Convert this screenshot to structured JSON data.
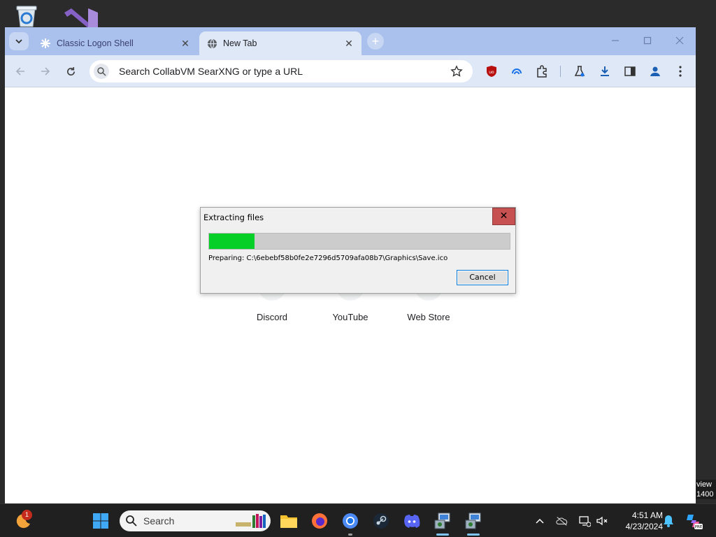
{
  "desktop": {
    "icons": [
      "recycle-bin-icon",
      "visual-studio-icon"
    ]
  },
  "browser": {
    "tabs": [
      {
        "label": "Classic Logon Shell",
        "icon": "spark-icon",
        "active": false
      },
      {
        "label": "New Tab",
        "icon": "globe-icon",
        "active": true
      }
    ],
    "omnibox": {
      "placeholder": "Search CollabVM SearXNG or type a URL"
    },
    "shortcuts": [
      {
        "label": "Discord"
      },
      {
        "label": "YouTube"
      },
      {
        "label": "Web Store"
      }
    ],
    "colors": {
      "tabstrip": "#a9c1ec",
      "toolbar": "#dfe8f7"
    }
  },
  "dialog": {
    "title": "Extracting files",
    "close": "✕",
    "progress": 0.15,
    "status": "Preparing: C:\\6ebebf58b0fe2e7296d5709afa08b7\\Graphics\\Save.ico",
    "cancel_label": "Cancel",
    "colors": {
      "progress_fill": "#06d027"
    }
  },
  "edge_fragment": {
    "line1": "view",
    "line2": "1400"
  },
  "taskbar": {
    "search_label": "Search",
    "notification_count": "1",
    "time": "4:51 AM",
    "date": "4/23/2024"
  }
}
